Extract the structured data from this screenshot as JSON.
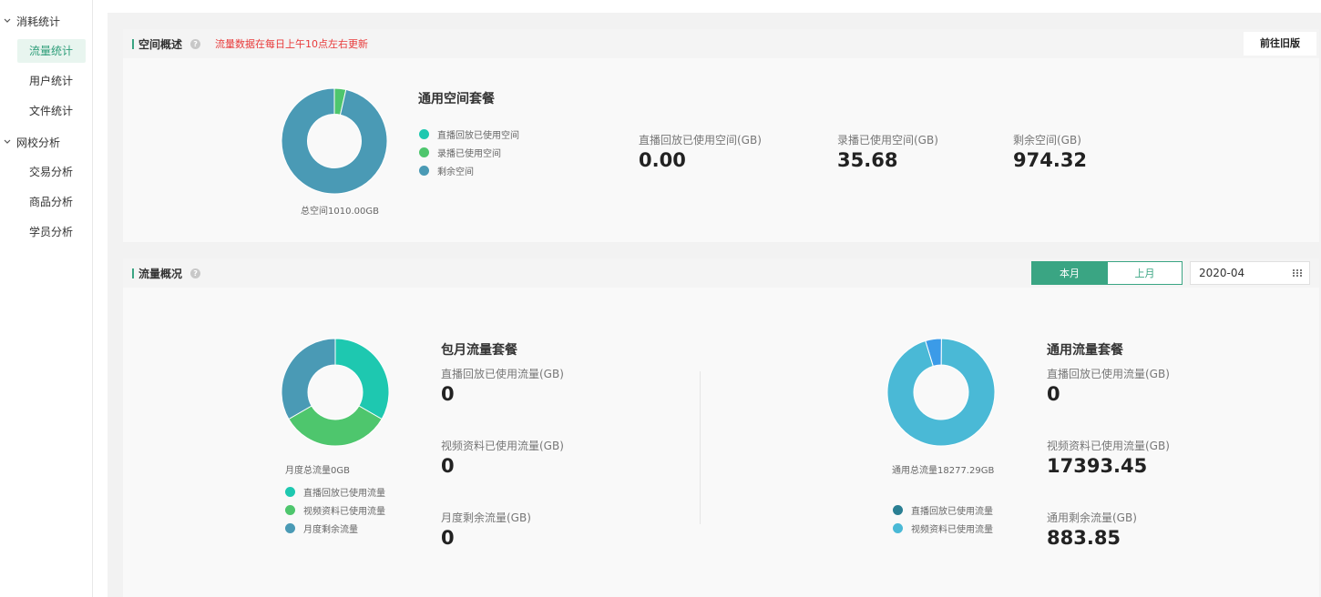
{
  "sidebar": {
    "groups": [
      {
        "label": "消耗统计",
        "items": [
          "流量统计",
          "用户统计",
          "文件统计"
        ]
      },
      {
        "label": "网校分析",
        "items": [
          "交易分析",
          "商品分析",
          "学员分析"
        ]
      }
    ],
    "active": "流量统计"
  },
  "space": {
    "title": "空间概述",
    "notice": "流量数据在每日上午10点左右更新",
    "old_button": "前往旧版",
    "package_title": "通用空间套餐",
    "total_caption": "总空间1010.00GB",
    "legend": [
      {
        "label": "直播回放已使用空间",
        "color": "#1ec8b0"
      },
      {
        "label": "录播已使用空间",
        "color": "#4ec66d"
      },
      {
        "label": "剩余空间",
        "color": "#4a9ab5"
      }
    ],
    "stats": [
      {
        "label": "直播回放已使用空间(GB)",
        "value": "0.00"
      },
      {
        "label": "录播已使用空间(GB)",
        "value": "35.68"
      },
      {
        "label": "剩余空间(GB)",
        "value": "974.32"
      }
    ],
    "chart_values": [
      0,
      35.68,
      974.32
    ]
  },
  "traffic": {
    "title": "流量概况",
    "tabs": [
      "本月",
      "上月"
    ],
    "active_tab": "本月",
    "month": "2020-04",
    "monthly": {
      "title": "包月流量套餐",
      "caption": "月度总流量0GB",
      "legend": [
        {
          "label": "直播回放已使用流量",
          "color": "#1ec8b0"
        },
        {
          "label": "视频资料已使用流量",
          "color": "#4ec66d"
        },
        {
          "label": "月度剩余流量",
          "color": "#4a9ab5"
        }
      ],
      "stats": [
        {
          "label": "直播回放已使用流量(GB)",
          "value": "0"
        },
        {
          "label": "视频资料已使用流量(GB)",
          "value": "0"
        },
        {
          "label": "月度剩余流量(GB)",
          "value": "0"
        }
      ]
    },
    "general": {
      "title": "通用流量套餐",
      "caption": "通用总流量18277.29GB",
      "legend": [
        {
          "label": "直播回放已使用流量",
          "color": "#2a7f93"
        },
        {
          "label": "视频资料已使用流量",
          "color": "#4ab9d6"
        }
      ],
      "stats": [
        {
          "label": "直播回放已使用流量(GB)",
          "value": "0"
        },
        {
          "label": "视频资料已使用流量(GB)",
          "value": "17393.45"
        },
        {
          "label": "通用剩余流量(GB)",
          "value": "883.85"
        }
      ]
    }
  }
}
